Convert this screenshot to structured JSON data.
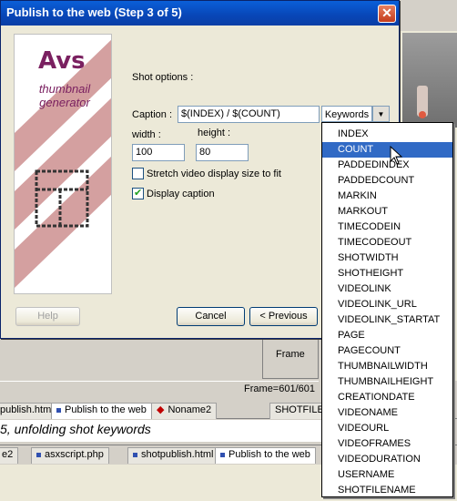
{
  "dialog": {
    "title": "Publish to the web (Step 3 of 5)",
    "close_label": "✕",
    "logo_main": "Avs",
    "logo_sub": "thumbnail generator",
    "section_label": "Shot options :",
    "caption_label": "Caption :",
    "caption_value": "$(INDEX) / $(COUNT)",
    "keywords_label": "Keywords",
    "width_label": "width :",
    "width_value": "100",
    "height_label": "height :",
    "height_value": "80",
    "stretch_label": "Stretch video display size to fit",
    "stretch_checked": false,
    "display_caption_label": "Display caption",
    "display_caption_checked": true,
    "help_label": "Help",
    "cancel_label": "Cancel",
    "previous_label": "< Previous"
  },
  "keywords_menu": {
    "selected_index": 1,
    "items": [
      "INDEX",
      "COUNT",
      "PADDEDINDEX",
      "PADDEDCOUNT",
      "MARKIN",
      "MARKOUT",
      "TIMECODEIN",
      "TIMECODEOUT",
      "SHOTWIDTH",
      "SHOTHEIGHT",
      "VIDEOLINK",
      "VIDEOLINK_URL",
      "VIDEOLINK_STARTAT",
      "PAGE",
      "PAGECOUNT",
      "THUMBNAILWIDTH",
      "THUMBNAILHEIGHT",
      "CREATIONDATE",
      "VIDEONAME",
      "VIDEOURL",
      "VIDEOFRAMES",
      "VIDEODURATION",
      "USERNAME",
      "SHOTFILENAME"
    ]
  },
  "background": {
    "frame_label": "Frame",
    "frame_status": "Frame=601/601",
    "shotfile_tab": "SHOTFILEN",
    "tabs_top": [
      "publish.html",
      "Publish to the web",
      "Noname2"
    ],
    "heading": "5, unfolding shot keywords",
    "tabs_bottom": [
      "e2",
      "asxscript.php",
      "shotpublish.html",
      "Publish to the web"
    ]
  },
  "colors": {
    "titlebar": "#0846b7",
    "selection": "#316ac5",
    "logo": "#7a2060"
  }
}
